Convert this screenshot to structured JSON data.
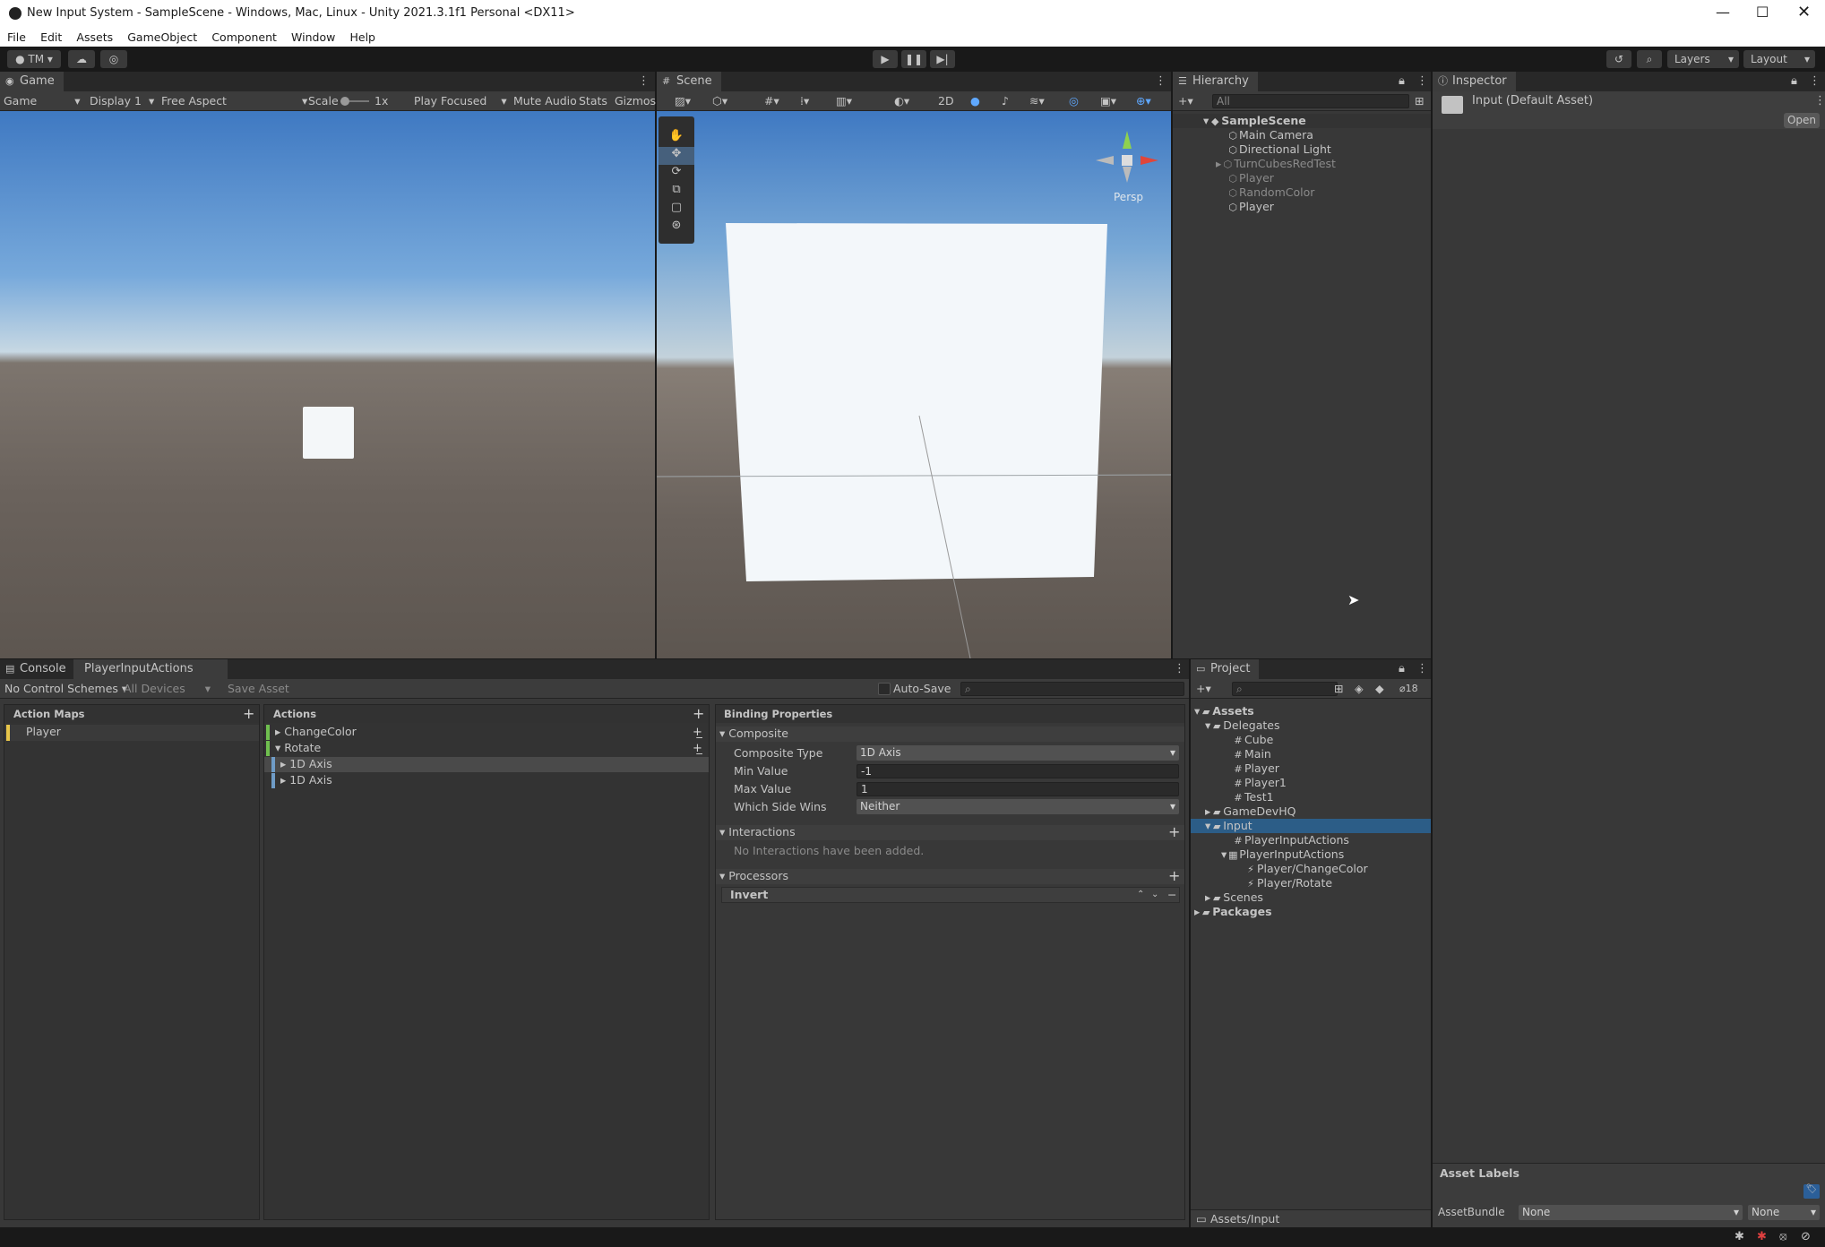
{
  "window": {
    "title": "New Input System - SampleScene - Windows, Mac, Linux - Unity 2021.3.1f1 Personal <DX11>"
  },
  "menu": [
    "File",
    "Edit",
    "Assets",
    "GameObject",
    "Component",
    "Window",
    "Help"
  ],
  "toolbar": {
    "account": "TM",
    "layers": "Layers",
    "layout": "Layout"
  },
  "game": {
    "tab": "Game",
    "mode": "Game",
    "display": "Display 1",
    "aspect": "Free Aspect",
    "scale_label": "Scale",
    "scale_value": "1x",
    "play_focused": "Play Focused",
    "mute_audio": "Mute Audio",
    "stats": "Stats",
    "gizmos": "Gizmos"
  },
  "scene": {
    "tab": "Scene",
    "mode_2d": "2D",
    "persp": "Persp"
  },
  "hierarchy": {
    "tab": "Hierarchy",
    "search_placeholder": "All",
    "root": "SampleScene",
    "items": [
      "Main Camera",
      "Directional Light",
      "TurnCubesRedTest",
      "Player",
      "RandomColor",
      "Player"
    ]
  },
  "inspector": {
    "tab": "Inspector",
    "asset": "Input (Default Asset)",
    "open": "Open",
    "asset_labels": "Asset Labels",
    "asset_bundle": "AssetBundle",
    "bundle_value": "None",
    "variant_value": "None"
  },
  "console": {
    "tab": "Console",
    "actions_tab": "PlayerInputActions (Input..."
  },
  "input_editor": {
    "control_schemes": "No Control Schemes",
    "devices": "All Devices",
    "save_asset": "Save Asset",
    "auto_save": "Auto-Save",
    "action_maps_header": "Action Maps",
    "action_maps": [
      "Player"
    ],
    "actions_header": "Actions",
    "actions": [
      "ChangeColor",
      "Rotate",
      "1D Axis",
      "1D Axis"
    ],
    "binding_header": "Binding Properties",
    "composite": "Composite",
    "composite_type_label": "Composite Type",
    "composite_type": "1D Axis",
    "min_label": "Min Value",
    "min_value": "-1",
    "max_label": "Max Value",
    "max_value": "1",
    "wins_label": "Which Side Wins",
    "wins_value": "Neither",
    "interactions": "Interactions",
    "no_interactions": "No Interactions have been added.",
    "processors": "Processors",
    "invert": "Invert"
  },
  "project": {
    "tab": "Project",
    "count": "18",
    "tree": [
      "Assets",
      "Delegates",
      "Cube",
      "Main",
      "Player",
      "Player1",
      "Test1",
      "GameDevHQ",
      "Input",
      "PlayerInputActions",
      "PlayerInputActions",
      "Player/ChangeColor",
      "Player/Rotate",
      "Scenes",
      "Packages"
    ],
    "path": "Assets/Input"
  },
  "colors": {
    "selection": "#2c5d87",
    "panel": "#383838",
    "accent_green": "#6fbf4f"
  }
}
